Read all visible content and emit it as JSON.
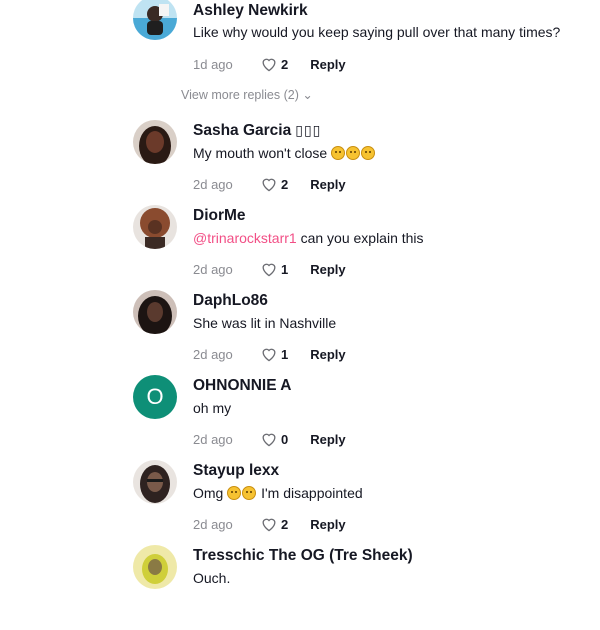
{
  "comments": [
    {
      "name": "Ashley Newkirk",
      "text": "Like why would you keep saying pull over that many times?",
      "age": "1d ago",
      "likes": "2",
      "reply": "Reply",
      "avatar_color": "#4aa9d6"
    },
    {
      "name": "Sasha Garcia",
      "name_glyphs": "▯▯▯",
      "text": "My mouth won't close",
      "emojis": "😂😂😂",
      "age": "2d ago",
      "likes": "2",
      "reply": "Reply",
      "avatar_color": "#6b3a2a"
    },
    {
      "name": "DiorMe",
      "mention": "@trinarockstarr1",
      "text": " can you explain this",
      "age": "2d ago",
      "likes": "1",
      "reply": "Reply",
      "avatar_color": "#8a4b2f"
    },
    {
      "name": "DaphLo86",
      "text": "She was lit in Nashville",
      "age": "2d ago",
      "likes": "1",
      "reply": "Reply",
      "avatar_color": "#2b1f1c"
    },
    {
      "name": "OHNONNIE A",
      "avatar_letter": "O",
      "text": "oh my",
      "age": "2d ago",
      "likes": "0",
      "reply": "Reply",
      "avatar_color": "#0e8f77"
    },
    {
      "name": "Stayup lexx",
      "text_before": "Omg ",
      "emojis": "😩😩",
      "text_after": " I'm disappointed",
      "age": "2d ago",
      "likes": "2",
      "reply": "Reply",
      "avatar_color": "#7a5a4a"
    },
    {
      "name": "Tresschic The OG (Tre Sheek)",
      "text": "Ouch.",
      "avatar_color": "#cfcf3a"
    }
  ],
  "view_more_replies": "View more replies (2) ⌄",
  "colors": {
    "mention": "#f24f86",
    "meta_gray": "#8a8b91",
    "text_dark": "#161823"
  }
}
